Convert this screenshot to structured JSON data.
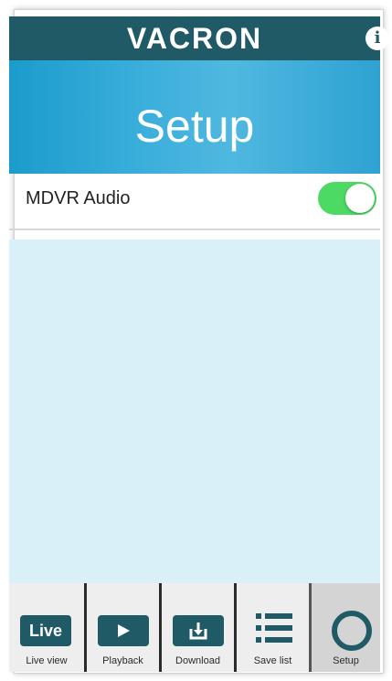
{
  "header": {
    "brand": "VACRON",
    "info_symbol": "i"
  },
  "hero": {
    "title": "Setup"
  },
  "settings": {
    "mdvr_audio": {
      "label": "MDVR Audio",
      "enabled": true
    }
  },
  "tabs": [
    {
      "id": "live",
      "icon_text": "Live",
      "icon": "live-badge-icon",
      "label": "Live view",
      "active": false
    },
    {
      "id": "playback",
      "icon": "play-icon",
      "label": "Playback",
      "active": false
    },
    {
      "id": "download",
      "icon": "download-icon",
      "label": "Download",
      "active": false
    },
    {
      "id": "savelist",
      "icon": "list-icon",
      "label": "Save list",
      "active": false
    },
    {
      "id": "setup",
      "icon": "ring-icon",
      "label": "Setup",
      "active": true
    }
  ],
  "colors": {
    "header_bg": "#1f5a66",
    "hero_bg": "#33a9d8",
    "toggle_on": "#4cd964",
    "content_bg": "#d9f0f8",
    "icon_box": "#1f5a66"
  }
}
